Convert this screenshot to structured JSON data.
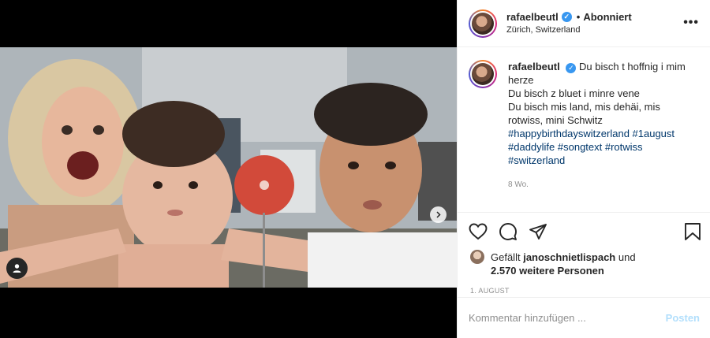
{
  "post": {
    "username": "rafaelbeutl",
    "follow_state": "Abonniert",
    "location": "Zürich, Switzerland",
    "more_icon": "more-horizontal-icon",
    "caption_lines": [
      "Du bisch t hoffnig i mim",
      "herze",
      "Du bisch z bluet i minre vene",
      "Du bisch mis land, mis dehäi, mis",
      "rotwiss, mini Schwitz"
    ],
    "hashtag_lines": [
      "#happybirthdayswitzerland #1august",
      "#daddylife #songtext #rotwiss",
      "#switzerland"
    ],
    "time_ago": "8 Wo.",
    "liked_by_prefix": "Gefällt",
    "liked_by_user": "janoschnietlispach",
    "liked_by_joiner": "und",
    "liked_by_others": "2.570 weitere Personen",
    "date": "1. AUGUST",
    "comment_placeholder": "Kommentar hinzufügen ...",
    "post_button": "Posten"
  },
  "colors": {
    "verified": "#3897f0",
    "hashtag": "#00376b",
    "muted": "#8e8e8e",
    "post_button_disabled": "#b2dffc"
  }
}
